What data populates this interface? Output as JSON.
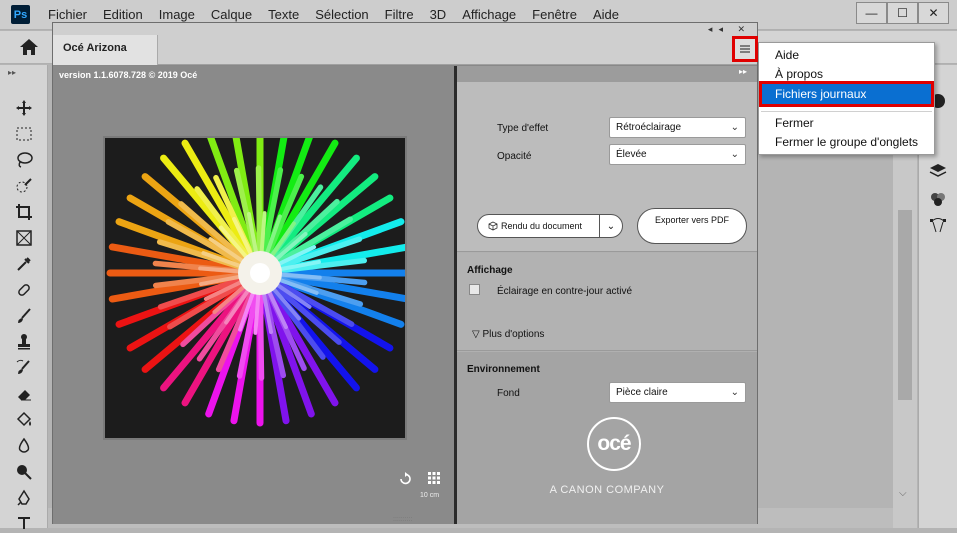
{
  "app": {
    "logo_text": "Ps",
    "menu": [
      "Fichier",
      "Edition",
      "Image",
      "Calque",
      "Texte",
      "Sélection",
      "Filtre",
      "3D",
      "Affichage",
      "Fenêtre",
      "Aide"
    ],
    "window_controls": {
      "minimize": "—",
      "maximize": "☐",
      "close": "✕"
    }
  },
  "panel": {
    "tab_title": "Océ Arizona Xpert",
    "collapse_glyphs": "◂◂ ✕",
    "version": "version 1.1.6078.728 © 2019 Océ",
    "preview_scale": "10 cm",
    "settings_collapse": "▸▸",
    "effect_type_label": "Type d'effet",
    "effect_type_value": "Rétroéclairage",
    "opacity_label": "Opacité",
    "opacity_value": "Élevée",
    "render_button": "Rendu du document",
    "export_button": "Exporter vers PDF",
    "display_title": "Affichage",
    "backlight_checkbox_label": "Éclairage en contre-jour activé",
    "more_options": "Plus d'options",
    "environment_title": "Environnement",
    "background_label": "Fond",
    "background_value": "Pièce claire",
    "logo_text": "océ",
    "company_text": "A CANON COMPANY"
  },
  "dropdown": {
    "items": [
      "Aide",
      "À propos",
      "Fichiers journaux",
      "Fermer",
      "Fermer le groupe d'onglets"
    ],
    "highlighted": "Fichiers journaux"
  },
  "colors": {
    "highlight_blue": "#0a6fd1",
    "annotation_red": "#e00000"
  }
}
